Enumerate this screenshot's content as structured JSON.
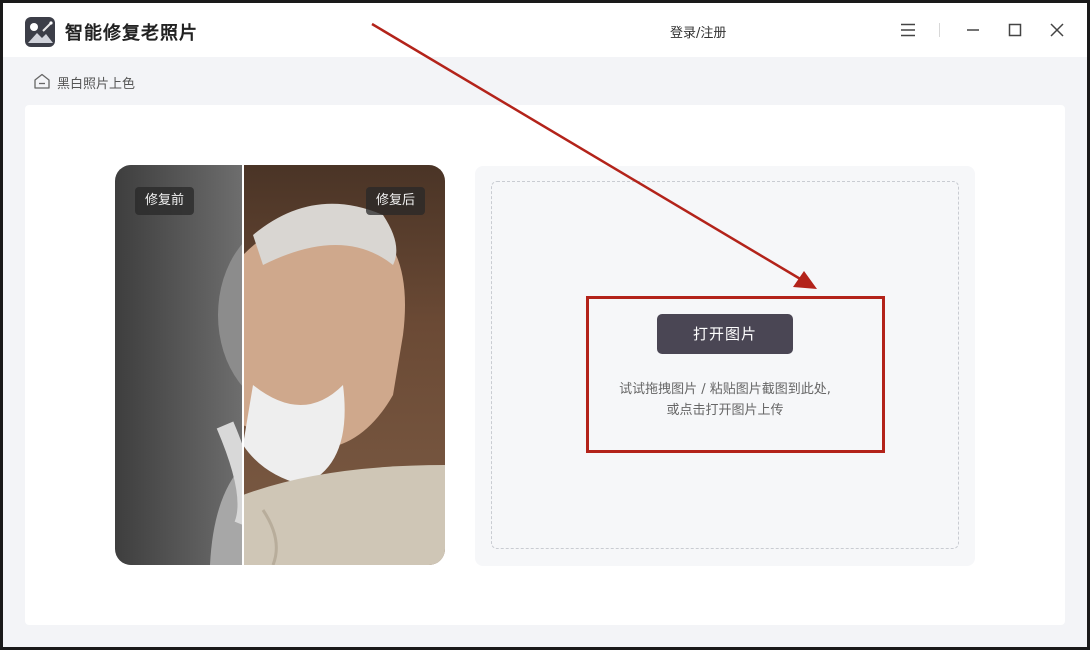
{
  "app": {
    "title": "智能修复老照片",
    "login_label": "登录/注册"
  },
  "breadcrumb": {
    "label": "黑白照片上色"
  },
  "preview": {
    "before_label": "修复前",
    "after_label": "修复后"
  },
  "upload": {
    "open_button_label": "打开图片",
    "hint_line1": "试试拖拽图片 / 粘贴图片截图到此处,",
    "hint_line2": "或点击打开图片上传"
  },
  "icons": {
    "logo": "app-logo-icon",
    "menu": "menu-icon",
    "minimize": "minimize-icon",
    "maximize": "maximize-icon",
    "close": "close-icon",
    "home": "home-icon"
  },
  "colors": {
    "accent_button": "#4a4654",
    "annotation_red": "#b3231a",
    "panel_bg": "#f6f7f9",
    "window_bg": "#f3f4f7"
  }
}
